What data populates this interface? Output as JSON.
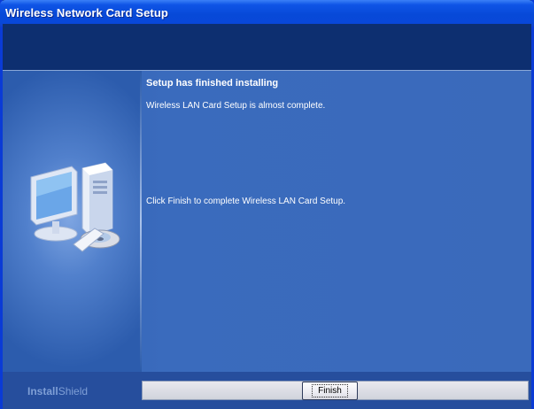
{
  "window": {
    "title": "Wireless Network Card Setup"
  },
  "main": {
    "heading": "Setup has finished installing",
    "text_line_1": "Wireless LAN Card Setup is almost complete.",
    "text_line_2": "Click Finish to complete Wireless LAN Card Setup."
  },
  "footer": {
    "brand_bold": "Install",
    "brand_thin": "Shield",
    "finish_label": "Finish"
  },
  "icons": {
    "setup_graphic": "computer-with-cd-icon"
  }
}
